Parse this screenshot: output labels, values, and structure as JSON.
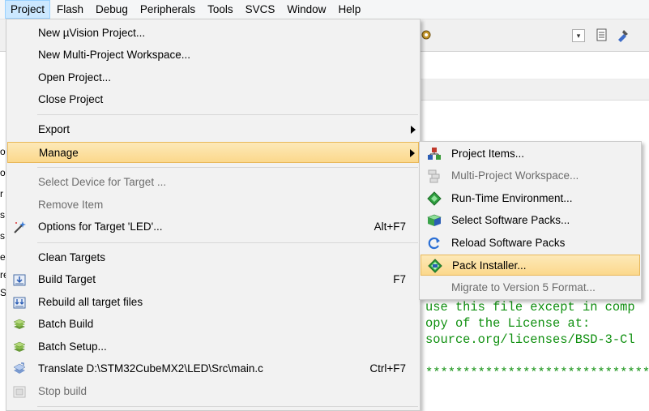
{
  "menubar": {
    "items": [
      "Project",
      "Flash",
      "Debug",
      "Peripherals",
      "Tools",
      "SVCS",
      "Window",
      "Help"
    ]
  },
  "project_menu": {
    "items": [
      {
        "label": "New µVision Project...",
        "shortcut": "",
        "enabled": true
      },
      {
        "label": "New Multi-Project Workspace...",
        "shortcut": "",
        "enabled": true
      },
      {
        "label": "Open Project...",
        "shortcut": "",
        "enabled": true
      },
      {
        "label": "Close Project",
        "shortcut": "",
        "enabled": true
      },
      {
        "label": "Export",
        "shortcut": "",
        "enabled": true,
        "submenu": true
      },
      {
        "label": "Manage",
        "shortcut": "",
        "enabled": true,
        "submenu": true,
        "highlighted": true
      },
      {
        "label": "Select Device for Target ...",
        "shortcut": "",
        "enabled": false
      },
      {
        "label": "Remove Item",
        "shortcut": "",
        "enabled": false
      },
      {
        "label": "Options for Target 'LED'...",
        "shortcut": "Alt+F7",
        "enabled": true,
        "icon": "magic-wand-icon"
      },
      {
        "label": "Clean Targets",
        "shortcut": "",
        "enabled": true
      },
      {
        "label": "Build Target",
        "shortcut": "F7",
        "enabled": true,
        "icon": "build-icon"
      },
      {
        "label": "Rebuild all target files",
        "shortcut": "",
        "enabled": true,
        "icon": "rebuild-icon"
      },
      {
        "label": "Batch Build",
        "shortcut": "",
        "enabled": true,
        "icon": "batch-build-icon"
      },
      {
        "label": "Batch Setup...",
        "shortcut": "",
        "enabled": true,
        "icon": "batch-setup-icon"
      },
      {
        "label": "Translate D:\\STM32CubeMX2\\LED\\Src\\main.c",
        "shortcut": "Ctrl+F7",
        "enabled": true,
        "icon": "translate-icon"
      },
      {
        "label": "Stop build",
        "shortcut": "",
        "enabled": false,
        "icon": "stop-build-icon"
      }
    ]
  },
  "manage_submenu": {
    "items": [
      {
        "label": "Project Items...",
        "enabled": true,
        "icon": "project-items-icon"
      },
      {
        "label": "Multi-Project Workspace...",
        "enabled": false,
        "icon": "workspace-icon"
      },
      {
        "label": "Run-Time Environment...",
        "enabled": true,
        "icon": "runtime-environment-icon"
      },
      {
        "label": "Select Software Packs...",
        "enabled": true,
        "icon": "software-packs-icon"
      },
      {
        "label": "Reload Software Packs",
        "enabled": true,
        "icon": "reload-icon"
      },
      {
        "label": "Pack Installer...",
        "enabled": true,
        "highlighted": true,
        "icon": "pack-installer-icon"
      },
      {
        "label": "Migrate to Version 5 Format...",
        "enabled": false,
        "icon": ""
      }
    ]
  },
  "editor": {
    "code_lines": [
      "use this file except in comp",
      "opy of the License at:",
      "source.org/licenses/BSD-3-Cl"
    ],
    "stars": "**********************************",
    "left_fragments": [
      "ol",
      "ol",
      "r",
      "s",
      "s",
      "e",
      "re",
      "S"
    ]
  },
  "colors": {
    "highlight": "#fbd88c",
    "menu_bg": "#f2f2f2",
    "code_comment": "#109010"
  }
}
